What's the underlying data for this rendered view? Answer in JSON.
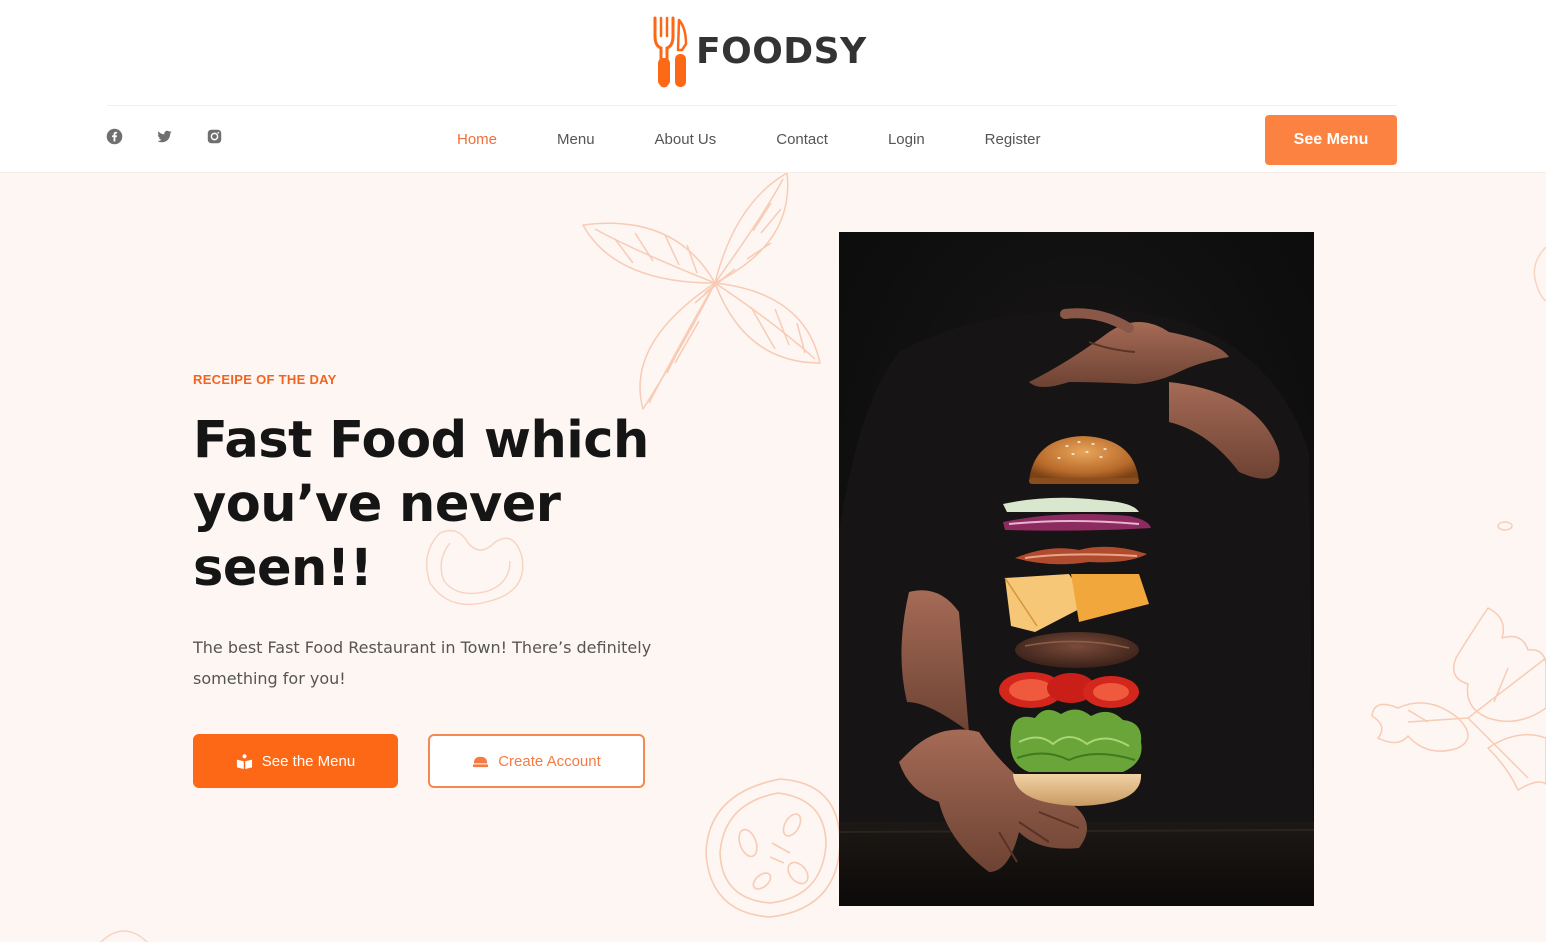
{
  "brand": {
    "name": "FOODSY",
    "logo_icon": "fork-knife-icon",
    "accent_color": "#fd6817"
  },
  "social": [
    {
      "name": "facebook",
      "icon": "facebook-icon"
    },
    {
      "name": "twitter",
      "icon": "twitter-icon"
    },
    {
      "name": "instagram",
      "icon": "instagram-icon"
    }
  ],
  "nav": {
    "items": [
      {
        "label": "Home",
        "active": true
      },
      {
        "label": "Menu",
        "active": false
      },
      {
        "label": "About Us",
        "active": false
      },
      {
        "label": "Contact",
        "active": false
      },
      {
        "label": "Login",
        "active": false
      },
      {
        "label": "Register",
        "active": false
      }
    ],
    "cta_label": "See Menu"
  },
  "hero": {
    "eyebrow": "RECEIPE OF THE DAY",
    "headline": "Fast Food which you’ve never seen!!",
    "subtext": "The best Fast Food Restaurant in Town! There’s definitely something for you!",
    "primary_button": {
      "label": "See the Menu",
      "icon": "menu-book-icon"
    },
    "secondary_button": {
      "label": "Create Account",
      "icon": "hat-icon"
    },
    "image": {
      "subject": "floating deconstructed burger between two hands",
      "icon": "burger-photo"
    }
  }
}
